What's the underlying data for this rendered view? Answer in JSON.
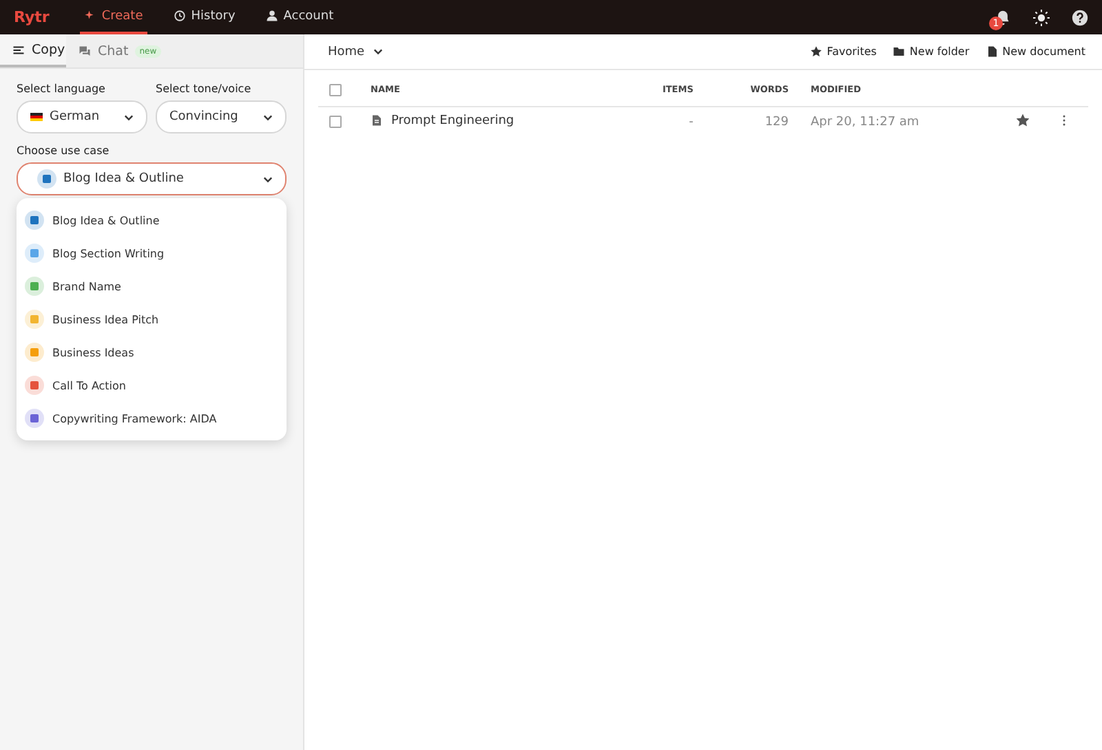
{
  "topbar": {
    "logo": "Rytr",
    "tabs": [
      {
        "label": "Create",
        "selected": true
      },
      {
        "label": "History",
        "selected": false
      },
      {
        "label": "Account",
        "selected": false
      }
    ],
    "notification_count": "1"
  },
  "sidebar": {
    "tabs": [
      {
        "label": "Copy",
        "selected": true
      },
      {
        "label": "Chat",
        "selected": false,
        "badge": "new"
      }
    ],
    "language": {
      "label": "Select language",
      "value": "German"
    },
    "tone": {
      "label": "Select tone/voice",
      "value": "Convincing"
    },
    "use_case": {
      "label": "Choose use case",
      "value": "Blog Idea & Outline",
      "color": "#1e73be"
    },
    "options": [
      {
        "label": "Blog Idea & Outline",
        "color": "#1e73be"
      },
      {
        "label": "Blog Section Writing",
        "color": "#5aa6e8"
      },
      {
        "label": "Brand Name",
        "color": "#4caf50"
      },
      {
        "label": "Business Idea Pitch",
        "color": "#f2b531"
      },
      {
        "label": "Business Ideas",
        "color": "#f59e0b"
      },
      {
        "label": "Call To Action",
        "color": "#e5533d"
      },
      {
        "label": "Copywriting Framework: AIDA",
        "color": "#6b63d6"
      }
    ]
  },
  "main": {
    "breadcrumb": "Home",
    "actions": [
      "Favorites",
      "New folder",
      "New document"
    ],
    "table": {
      "select_all_checked": false,
      "columns": [
        "NAME",
        "ITEMS",
        "WORDS",
        "MODIFIED"
      ],
      "rows": [
        {
          "name": "Prompt Engineering",
          "items": "-",
          "words": "129",
          "modified": "Apr 20, 11:27 am",
          "checked": false,
          "starred": true
        }
      ]
    }
  }
}
